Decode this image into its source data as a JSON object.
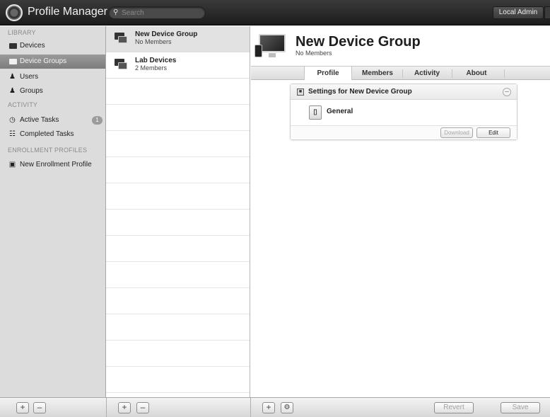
{
  "app": {
    "title": "Profile Manager"
  },
  "search": {
    "placeholder": "Search"
  },
  "user": {
    "label": "Local Admin"
  },
  "sidebar": {
    "library_header": "LIBRARY",
    "activity_header": "ACTIVITY",
    "enrollment_header": "ENROLLMENT PROFILES",
    "items": [
      {
        "label": "Devices",
        "icon": "device-icon",
        "selected": false
      },
      {
        "label": "Device Groups",
        "icon": "device-group-icon",
        "selected": true
      },
      {
        "label": "Users",
        "icon": "user-icon",
        "selected": false
      },
      {
        "label": "Groups",
        "icon": "groups-icon",
        "selected": false
      },
      {
        "label": "Active Tasks",
        "icon": "active-tasks-icon",
        "badge": "1"
      },
      {
        "label": "Completed Tasks",
        "icon": "completed-tasks-icon"
      },
      {
        "label": "New Enrollment Profile",
        "icon": "enrollment-profile-icon"
      }
    ]
  },
  "list": {
    "rows": [
      {
        "title": "New Device Group",
        "subtitle": "No Members",
        "selected": true
      },
      {
        "title": "Lab Devices",
        "subtitle": "2 Members",
        "selected": false
      }
    ]
  },
  "detail": {
    "title": "New Device Group",
    "subtitle": "No Members",
    "tabs": [
      "Profile",
      "Members",
      "Activity",
      "About"
    ],
    "active_tab": "Profile",
    "settings": {
      "title": "Settings for New Device Group",
      "payload": "General",
      "download_label": "Download",
      "edit_label": "Edit"
    }
  },
  "bottombar": {
    "revert_label": "Revert",
    "save_label": "Save"
  }
}
